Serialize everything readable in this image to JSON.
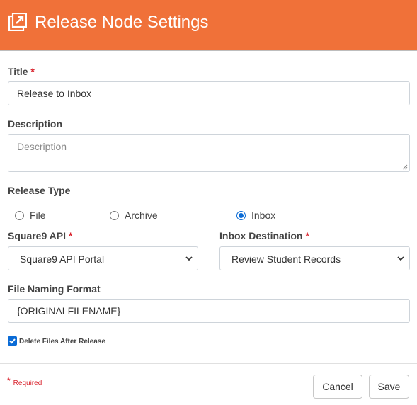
{
  "header": {
    "title": "Release Node Settings",
    "icon": "external-link-icon",
    "background": "#f07139"
  },
  "form": {
    "title": {
      "label": "Title",
      "required_mark": "*",
      "value": "Release to Inbox"
    },
    "description": {
      "label": "Description",
      "placeholder": "Description",
      "value": ""
    },
    "release_type": {
      "label": "Release Type",
      "options": [
        "File",
        "Archive",
        "Inbox"
      ],
      "selected": "Inbox"
    },
    "square9_api": {
      "label": "Square9 API",
      "required_mark": "*",
      "selected": "Square9 API Portal"
    },
    "inbox_destination": {
      "label": "Inbox Destination",
      "required_mark": "*",
      "selected": "Review Student Records"
    },
    "file_naming": {
      "label": "File Naming Format",
      "value": "{ORIGINALFILENAME}"
    },
    "delete_files": {
      "label": "Delete Files After Release",
      "checked": true
    }
  },
  "footer": {
    "required_star": "*",
    "required_note": "Required",
    "cancel_label": "Cancel",
    "save_label": "Save"
  },
  "colors": {
    "accent": "#f07139",
    "required": "#d9232d",
    "checkbox": "#0a6bd6"
  }
}
